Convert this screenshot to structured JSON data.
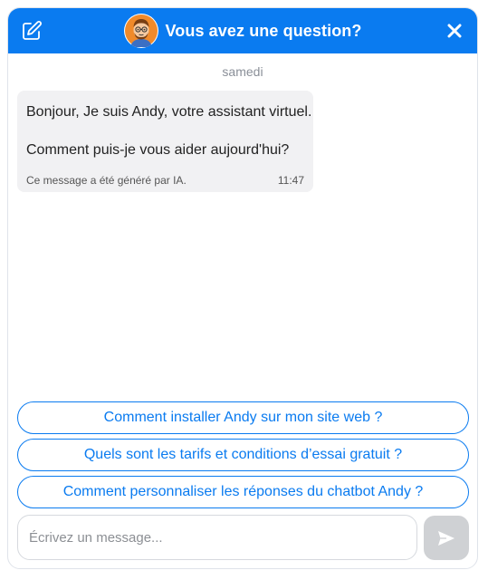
{
  "header": {
    "title": "Vous avez une question?",
    "accent_color": "#0a7bf0",
    "edit_icon": "edit-icon",
    "close_icon": "close-icon",
    "avatar_icon": "bot-avatar"
  },
  "conversation": {
    "day_label": "samedi",
    "messages": [
      {
        "line1": "Bonjour, Je suis Andy, votre assistant virtuel.",
        "line2": "Comment puis-je vous aider aujourd'hui?",
        "note": "Ce message a été généré par IA.",
        "time": "11:47"
      }
    ]
  },
  "suggestions": [
    {
      "label": "Comment installer Andy sur mon site web ?"
    },
    {
      "label": "Quels sont les tarifs et conditions d’essai gratuit ?"
    },
    {
      "label": "Comment personnaliser les réponses du chatbot Andy ?"
    }
  ],
  "composer": {
    "placeholder": "Écrivez un message...",
    "send_icon": "send-icon"
  }
}
